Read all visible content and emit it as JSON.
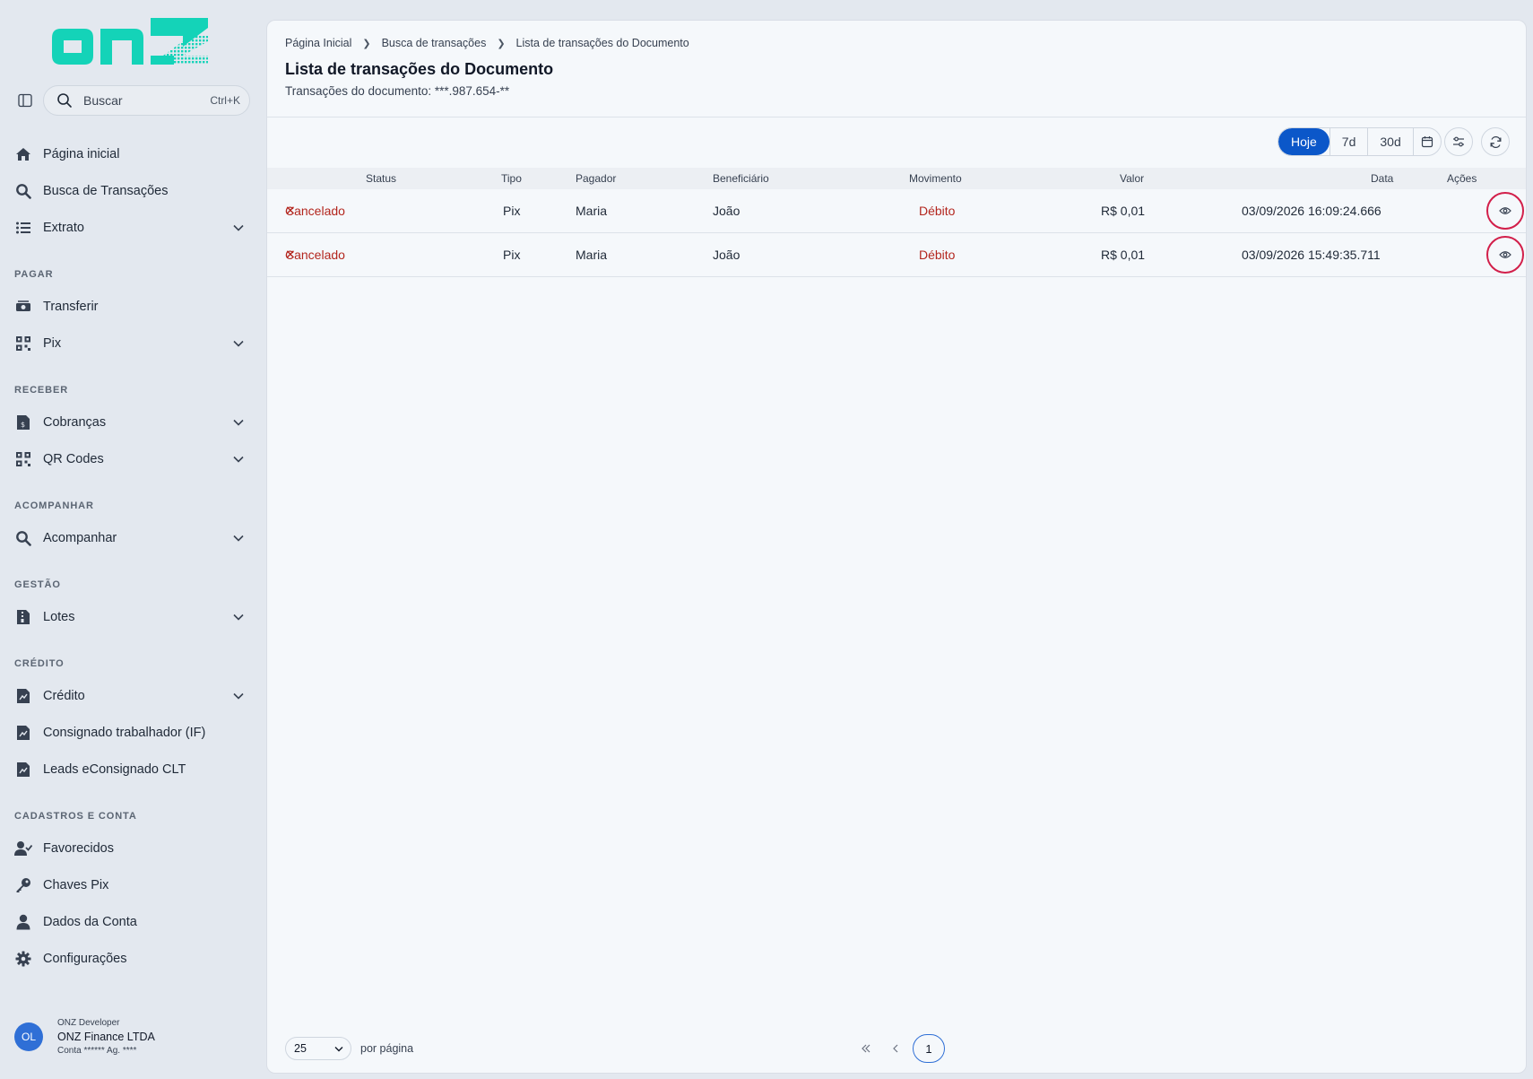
{
  "brand": {
    "logo_text": "onz",
    "accent": "#14d3b8"
  },
  "search": {
    "placeholder": "Buscar",
    "shortcut": "Ctrl+K"
  },
  "sidebar": {
    "items": [
      {
        "label": "Página inicial",
        "icon": "home-icon"
      },
      {
        "label": "Busca de Transações",
        "icon": "search-icon"
      },
      {
        "label": "Extrato",
        "icon": "list-icon"
      }
    ],
    "sections": [
      {
        "title": "PAGAR",
        "items": [
          {
            "label": "Transferir",
            "icon": "money-transfer-icon"
          },
          {
            "label": "Pix",
            "icon": "qr-grid-icon"
          }
        ]
      },
      {
        "title": "RECEBER",
        "items": [
          {
            "label": "Cobranças",
            "icon": "invoice-icon"
          },
          {
            "label": "QR Codes",
            "icon": "qr-grid-icon"
          }
        ]
      },
      {
        "title": "ACOMPANHAR",
        "items": [
          {
            "label": "Acompanhar",
            "icon": "search-icon"
          }
        ]
      },
      {
        "title": "GESTÃO",
        "items": [
          {
            "label": "Lotes",
            "icon": "file-zip-icon"
          }
        ]
      },
      {
        "title": "CRÉDITO",
        "items": [
          {
            "label": "Crédito",
            "icon": "file-chart-icon"
          },
          {
            "label": "Consignado trabalhador (IF)",
            "icon": "file-chart-icon"
          },
          {
            "label": "Leads eConsignado CLT",
            "icon": "file-chart-icon"
          }
        ]
      },
      {
        "title": "CADASTROS E CONTA",
        "items": [
          {
            "label": "Favorecidos",
            "icon": "user-check-icon"
          },
          {
            "label": "Chaves Pix",
            "icon": "key-icon"
          },
          {
            "label": "Dados da Conta",
            "icon": "user-icon"
          },
          {
            "label": "Configurações",
            "icon": "gear-icon"
          }
        ]
      }
    ]
  },
  "user": {
    "initials": "OL",
    "role": "ONZ Developer",
    "company": "ONZ Finance LTDA",
    "account": "Conta ****** Ag. ****"
  },
  "breadcrumb": [
    "Página Inicial",
    "Busca de transações",
    "Lista de transações do Documento"
  ],
  "page": {
    "title": "Lista de transações do Documento",
    "subtitle": "Transações do documento: ***.987.654-**"
  },
  "filters": {
    "ranges": [
      "Hoje",
      "7d",
      "30d"
    ],
    "active": "Hoje"
  },
  "table": {
    "columns": [
      "Status",
      "Tipo",
      "Pagador",
      "Beneficiário",
      "Movimento",
      "Valor",
      "Data",
      "Ações"
    ],
    "rows": [
      {
        "status": "Cancelado",
        "tipo": "Pix",
        "pagador": "Maria",
        "beneficiario": "João",
        "movimento": "Débito",
        "valor": "R$ 0,01",
        "data": "03/09/2026 16:09:24.666"
      },
      {
        "status": "Cancelado",
        "tipo": "Pix",
        "pagador": "Maria",
        "beneficiario": "João",
        "movimento": "Débito",
        "valor": "R$ 0,01",
        "data": "03/09/2026 15:49:35.711"
      }
    ]
  },
  "pagination": {
    "per_page": "25",
    "per_page_label": "por página",
    "current_page": "1"
  },
  "colors": {
    "primary": "#0b57c9",
    "danger": "#b3261e",
    "highlight_ring": "#d21f4a"
  }
}
